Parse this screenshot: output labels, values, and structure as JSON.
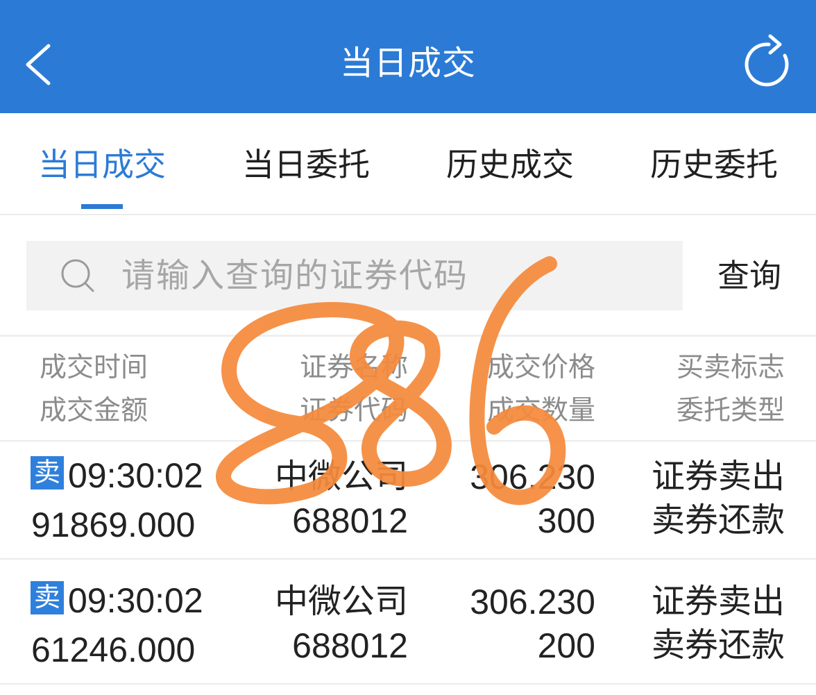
{
  "colors": {
    "primary": "#2b7bd6",
    "badge": "#2f80dc",
    "muted": "#8c8c8c"
  },
  "header": {
    "title": "当日成交",
    "back_icon": "chevron-left-icon",
    "refresh_icon": "refresh-icon"
  },
  "tabs": [
    {
      "label": "当日成交",
      "active": true
    },
    {
      "label": "当日委托",
      "active": false
    },
    {
      "label": "历史成交",
      "active": false
    },
    {
      "label": "历史委托",
      "active": false
    }
  ],
  "search": {
    "icon": "search-icon",
    "placeholder": "请输入查询的证券代码",
    "button_label": "查询"
  },
  "columns": [
    {
      "top": "成交时间",
      "bottom": "成交金额"
    },
    {
      "top": "证券名称",
      "bottom": "证券代码"
    },
    {
      "top": "成交价格",
      "bottom": "成交数量"
    },
    {
      "top": "买卖标志",
      "bottom": "委托类型"
    }
  ],
  "rows": [
    {
      "side_badge": "卖",
      "time": "09:30:02",
      "amount": "91869.000",
      "name": "中微公司",
      "code": "688012",
      "price": "306.230",
      "quantity": "300",
      "direction": "证券卖出",
      "order_type": "卖券还款"
    },
    {
      "side_badge": "卖",
      "time": "09:30:02",
      "amount": "61246.000",
      "name": "中微公司",
      "code": "688012",
      "price": "306.230",
      "quantity": "200",
      "direction": "证券卖出",
      "order_type": "卖券还款"
    }
  ],
  "annotation": {
    "text": "886",
    "color": "#f58a3c"
  }
}
